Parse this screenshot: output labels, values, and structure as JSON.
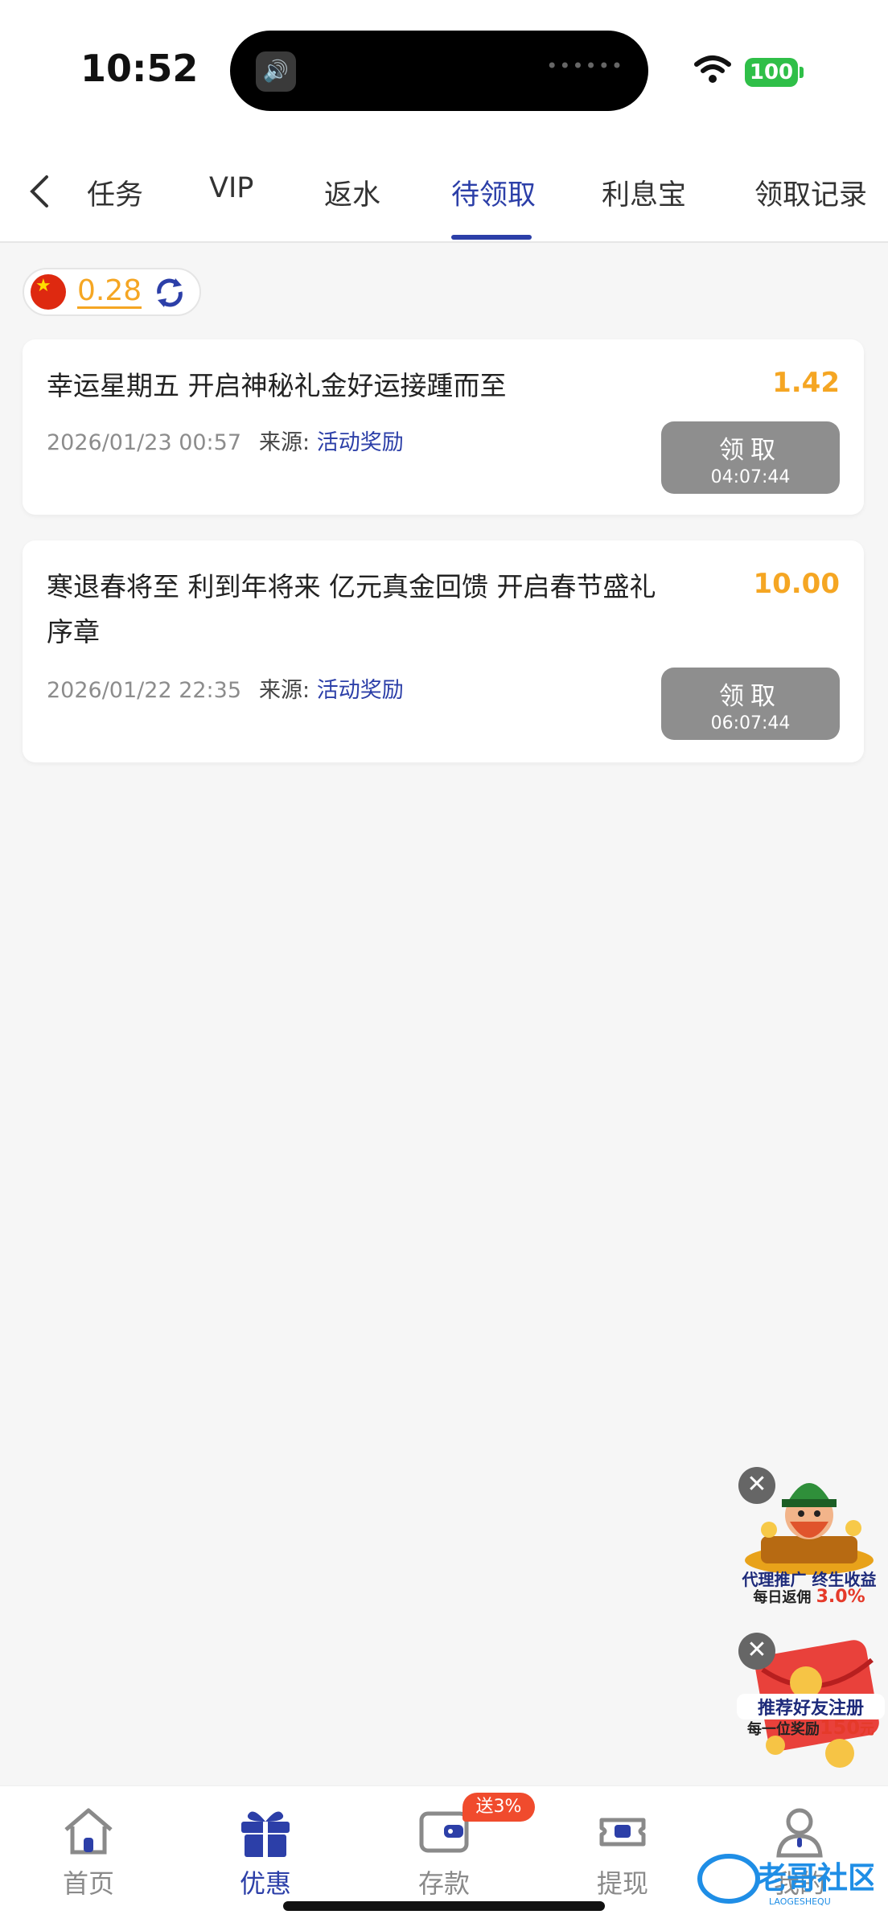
{
  "status_bar": {
    "time": "10:52",
    "battery": "100",
    "island_dots": "••••••"
  },
  "tabs": {
    "items": [
      {
        "label": "任务"
      },
      {
        "label": "VIP"
      },
      {
        "label": "返水"
      },
      {
        "label": "待领取"
      },
      {
        "label": "利息宝"
      },
      {
        "label": "领取记录"
      }
    ],
    "active_index": 3
  },
  "balance": {
    "value": "0.28"
  },
  "rewards": [
    {
      "title": "幸运星期五 开启神秘礼金好运接踵而至",
      "amount": "1.42",
      "datetime": "2026/01/23 00:57",
      "source_label": "来源:",
      "source_value": "活动奖励",
      "claim_label": "领取",
      "countdown": "04:07:44"
    },
    {
      "title": "寒退春将至 利到年将来 亿元真金回馈 开启春节盛礼序章",
      "amount": "10.00",
      "datetime": "2026/01/22 22:35",
      "source_label": "来源:",
      "source_value": "活动奖励",
      "claim_label": "领取",
      "countdown": "06:07:44"
    }
  ],
  "promos": {
    "agent": {
      "line1": "代理推广 终生收益",
      "line2_prefix": "每日返佣",
      "line2_value": "3.0%"
    },
    "referral": {
      "line1": "推荐好友注册",
      "line2_prefix": "每一位奖励",
      "line2_value": "150",
      "line2_suffix": "元"
    }
  },
  "bottom_nav": {
    "items": [
      {
        "label": "首页",
        "icon": "home-icon"
      },
      {
        "label": "优惠",
        "icon": "gift-icon"
      },
      {
        "label": "存款",
        "icon": "wallet-icon"
      },
      {
        "label": "提现",
        "icon": "withdraw-icon"
      },
      {
        "label": "我的",
        "icon": "profile-icon"
      }
    ],
    "active_index": 1,
    "deposit_badge": "送3%"
  },
  "watermark": {
    "text": "老哥社区",
    "subtext": "LAOGESHEQU"
  },
  "colors": {
    "accent": "#2c3fa8",
    "amount": "#f5a623",
    "button_disabled": "#8e8e8e",
    "badge": "#f04b2d"
  }
}
